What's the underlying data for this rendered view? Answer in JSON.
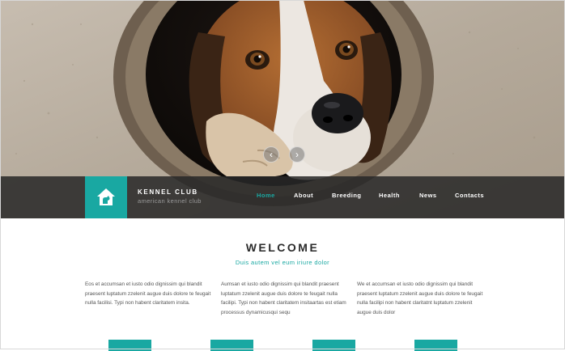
{
  "brand": {
    "title": "KENNEL CLUB",
    "subtitle": "american kennel club",
    "logo_icon": "house-dog-icon",
    "accent_color": "#19a8a2"
  },
  "hero": {
    "prev_icon": "chevron-left-icon",
    "next_icon": "chevron-right-icon",
    "prev_glyph": "‹",
    "next_glyph": "›"
  },
  "nav": {
    "items": [
      {
        "label": "Home",
        "active": true
      },
      {
        "label": "About",
        "active": false
      },
      {
        "label": "Breeding",
        "active": false
      },
      {
        "label": "Health",
        "active": false
      },
      {
        "label": "News",
        "active": false
      },
      {
        "label": "Contacts",
        "active": false
      }
    ]
  },
  "welcome": {
    "title": "WELCOME",
    "subtitle": "Duis autem vel eum iriure dolor",
    "columns": [
      "Eos et accumsan et iusto odio dignissim qui blandit praesent luptatum zzelenit augue duis dolore te feugait nulla facilisi. Typi non habent claritatem insita.",
      "Aumsan et iusto odio dignissim qui blandit praesent luptatum zzelenit augue duis dolore te feugait nulla facilipi. Typi non habent claritatem insitaartas est etiam processus dynamicusqui sequ",
      "We et accumsan et iusto odio dignissim qui blandit praesent luptatum zzelenit augue duis dolore te feugait nulla facilipi non habent claritatnt luptatum zzelenit augue duis dolor"
    ]
  }
}
